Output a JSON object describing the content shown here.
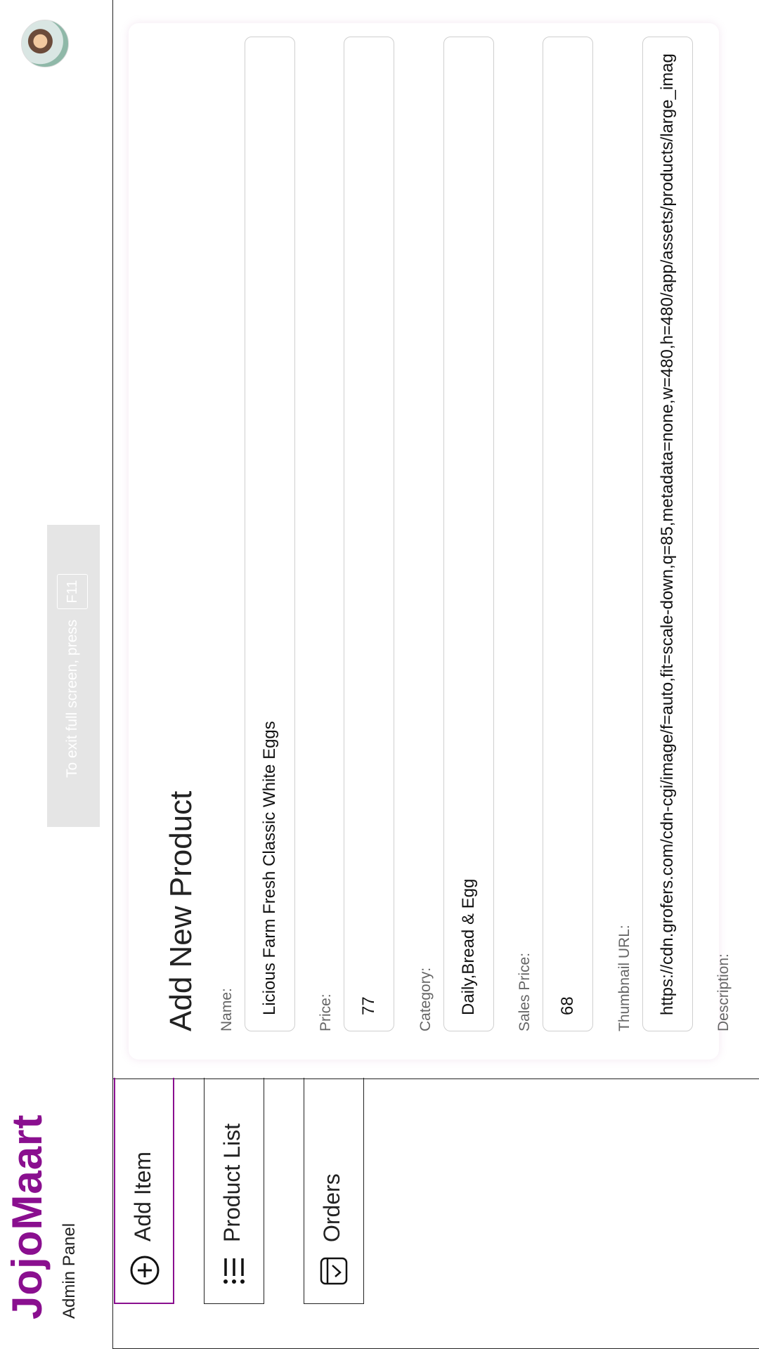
{
  "brand": {
    "name": "JojoMaart",
    "subtitle": "Admin Panel",
    "color": "#8a0f8f"
  },
  "sidebar": {
    "items": [
      {
        "label": "Add Item",
        "icon": "plus-circle-icon",
        "active": true
      },
      {
        "label": "Product List",
        "icon": "list-icon",
        "active": false
      },
      {
        "label": "Orders",
        "icon": "orders-check-icon",
        "active": false
      }
    ]
  },
  "form": {
    "title": "Add New Product",
    "fields": {
      "name": {
        "label": "Name:",
        "value": "Licious Farm Fresh Classic White Eggs"
      },
      "price": {
        "label": "Price:",
        "value": "77"
      },
      "category": {
        "label": "Category:",
        "value": "Daily,Bread & Egg"
      },
      "sales_price": {
        "label": "Sales Price:",
        "value": "68"
      },
      "thumbnail": {
        "label": "Thumbnail URL:",
        "value": "https://cdn.grofers.com/cdn-cgi/image/f=auto,fit=scale-down,q=85,metadata=none,w=480,h=480/app/assets/products/large_images/jpeg/"
      },
      "description": {
        "label": "Description:"
      }
    }
  },
  "toast": {
    "message": "To exit full screen, press",
    "key": "F11"
  }
}
